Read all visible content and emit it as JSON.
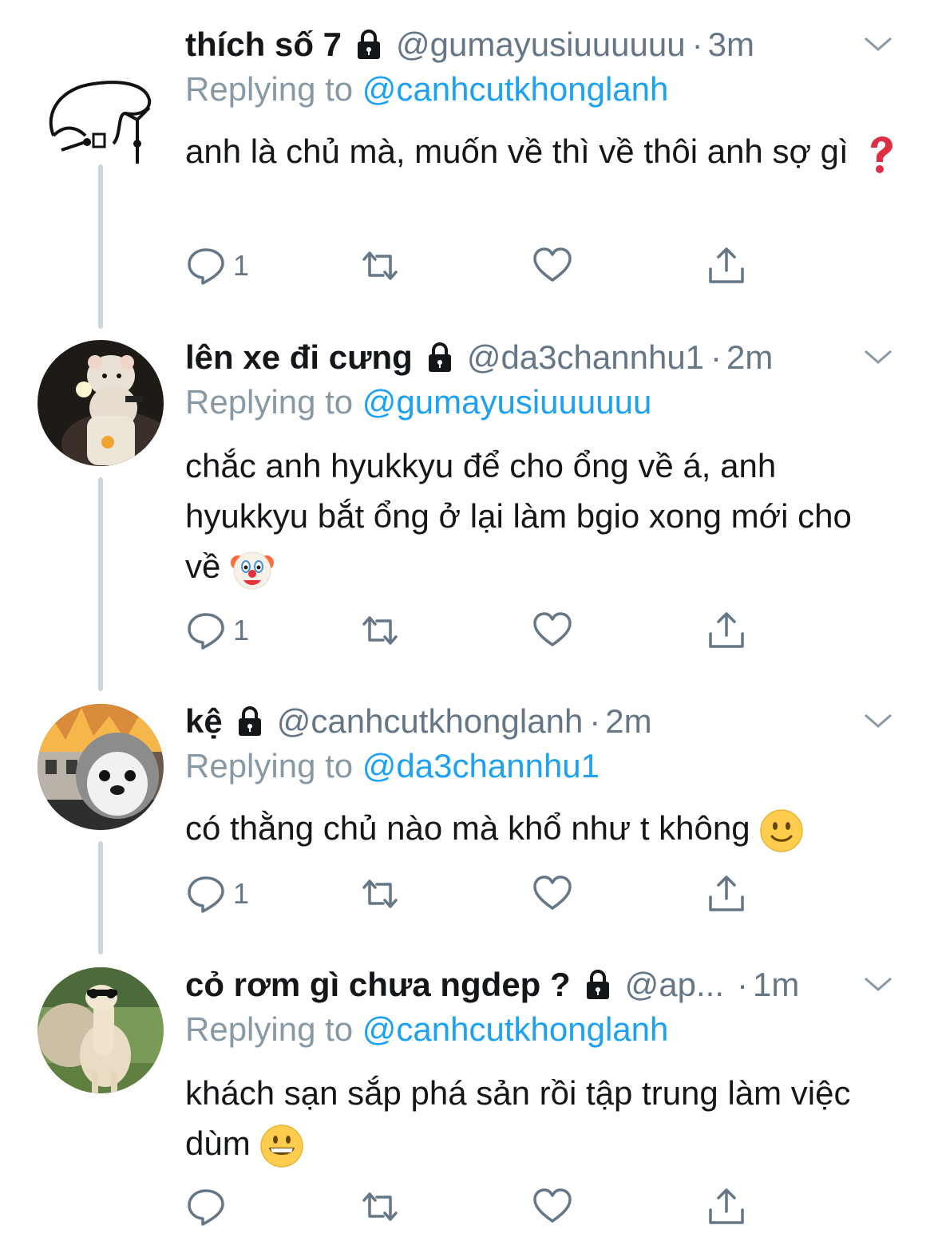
{
  "tweets": [
    {
      "name": "thích số 7",
      "handle": "@gumayusiuuuuuu",
      "sep": "·",
      "time": "3m",
      "replying_label": "Replying to ",
      "replying_to": "@canhcutkhonglanh",
      "text": "anh là chủ mà, muốn về thì về thôi anh sợ gì",
      "emoji": "red-question-mark-icon",
      "reply_count": "1"
    },
    {
      "name": "lên xe đi cưng",
      "handle": "@da3channhu1",
      "sep": "·",
      "time": "2m",
      "replying_label": "Replying to ",
      "replying_to": "@gumayusiuuuuuu",
      "text": "chắc anh hyukkyu để cho ổng về á, anh hyukkyu bắt ổng ở lại làm bgio xong mới cho về",
      "emoji": "clown-face-icon",
      "reply_count": "1"
    },
    {
      "name": "kệ",
      "handle": "@canhcutkhonglanh",
      "sep": "·",
      "time": "2m",
      "replying_label": "Replying to ",
      "replying_to": "@da3channhu1",
      "text": "có thằng chủ nào mà khổ như t không",
      "emoji": "slightly-smiling-face-icon",
      "reply_count": "1"
    },
    {
      "name": "cỏ rơm gì chưa ngdep ?",
      "handle": "@ap...",
      "sep": "·",
      "time": "1m",
      "replying_label": "Replying to ",
      "replying_to": "@canhcutkhonglanh",
      "text": "khách sạn sắp phá sản rồi tập trung làm việc dùm",
      "emoji": "grinning-face-icon",
      "reply_count": ""
    }
  ],
  "colors": {
    "link": "#1da1f2",
    "secondary": "#657786",
    "reply_label": "#8899a6",
    "thread_line": "#cdd6dd",
    "icon": "#657786"
  }
}
